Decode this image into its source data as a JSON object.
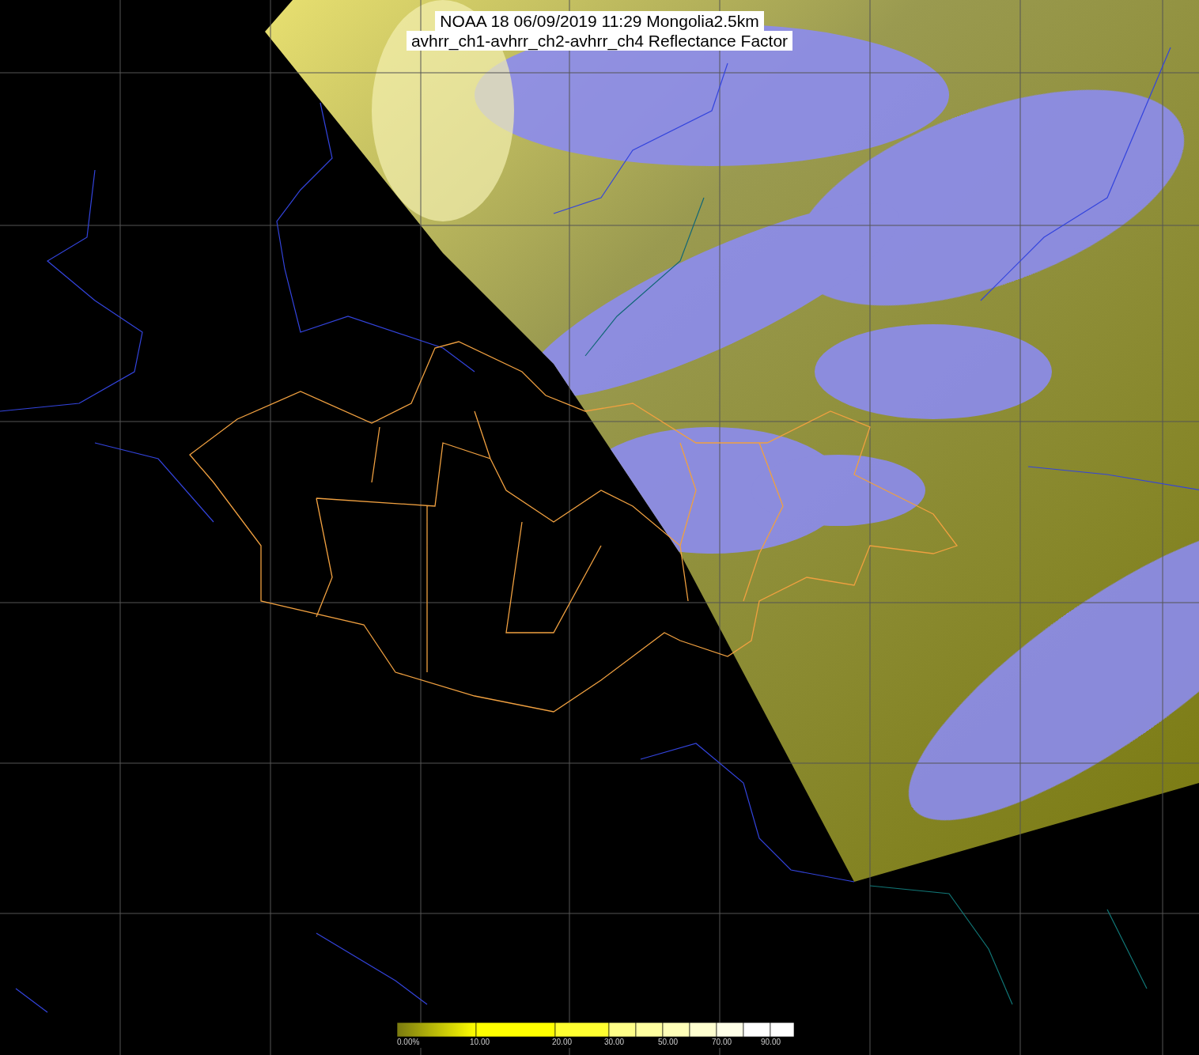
{
  "title": {
    "lines": [
      "NOAA 18 06/09/2019 11:29 Mongolia2.5km",
      "avhrr_ch1-avhrr_ch2-avhrr_ch4 Reflectance Factor"
    ]
  },
  "legend": {
    "labels": [
      "0.00%",
      "10.00",
      "20.00",
      "30.00",
      "50.00",
      "70.00",
      "90.00"
    ]
  }
}
